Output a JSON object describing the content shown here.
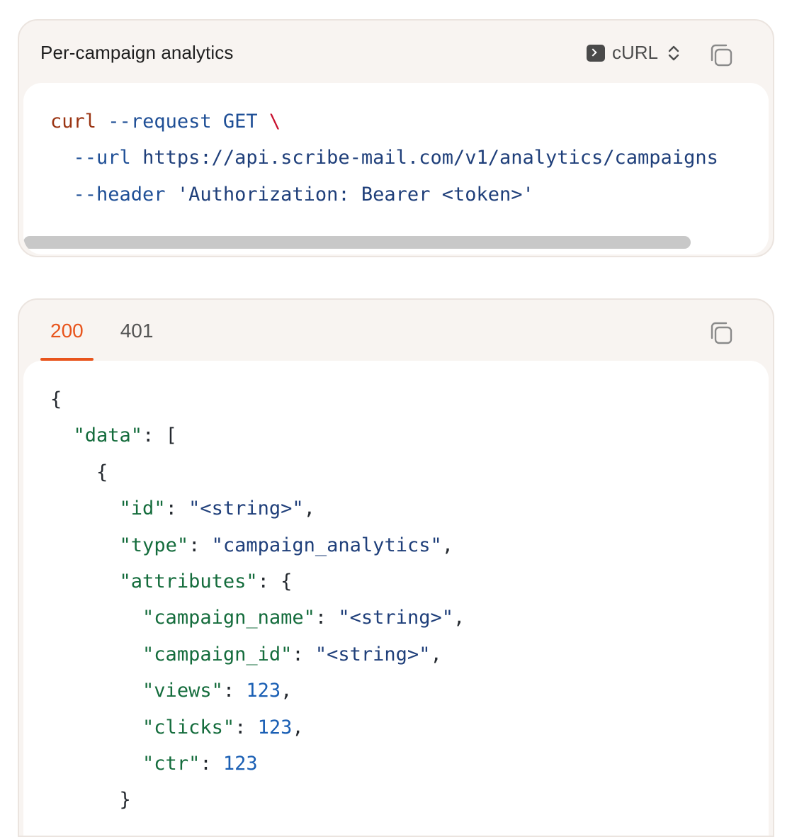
{
  "request_card": {
    "title": "Per-campaign analytics",
    "language": "cURL",
    "icons": {
      "language": "terminal-icon",
      "selector": "chevron-up-down-icon",
      "copy": "copy-icon"
    },
    "code": {
      "line1": {
        "cmd": "curl",
        "flag": "--request",
        "method": "GET",
        "cont": "\\"
      },
      "line2": {
        "flag": "--url",
        "value": "https://api.scribe-mail.com/v1/analytics/campaigns"
      },
      "line3": {
        "flag": "--header",
        "value": "'Authorization: Bearer <token>'"
      }
    }
  },
  "response_card": {
    "tabs": [
      {
        "label": "200",
        "active": true
      },
      {
        "label": "401",
        "active": false
      }
    ],
    "icons": {
      "copy": "copy-icon"
    },
    "code": {
      "open_brace": "{",
      "data_key": "\"data\"",
      "data_open": "[",
      "item_open": "{",
      "id_key": "\"id\"",
      "id_val": "\"<string>\"",
      "type_key": "\"type\"",
      "type_val": "\"campaign_analytics\"",
      "attributes_key": "\"attributes\"",
      "attributes_open": "{",
      "campaign_name_key": "\"campaign_name\"",
      "campaign_name_val": "\"<string>\"",
      "campaign_id_key": "\"campaign_id\"",
      "campaign_id_val": "\"<string>\"",
      "views_key": "\"views\"",
      "views_val": "123",
      "clicks_key": "\"clicks\"",
      "clicks_val": "123",
      "ctr_key": "\"ctr\"",
      "ctr_val": "123",
      "attributes_close": "}"
    }
  },
  "colors": {
    "accent": "#e8541c",
    "card_bg": "#f8f4f1",
    "code_bg": "#ffffff"
  }
}
